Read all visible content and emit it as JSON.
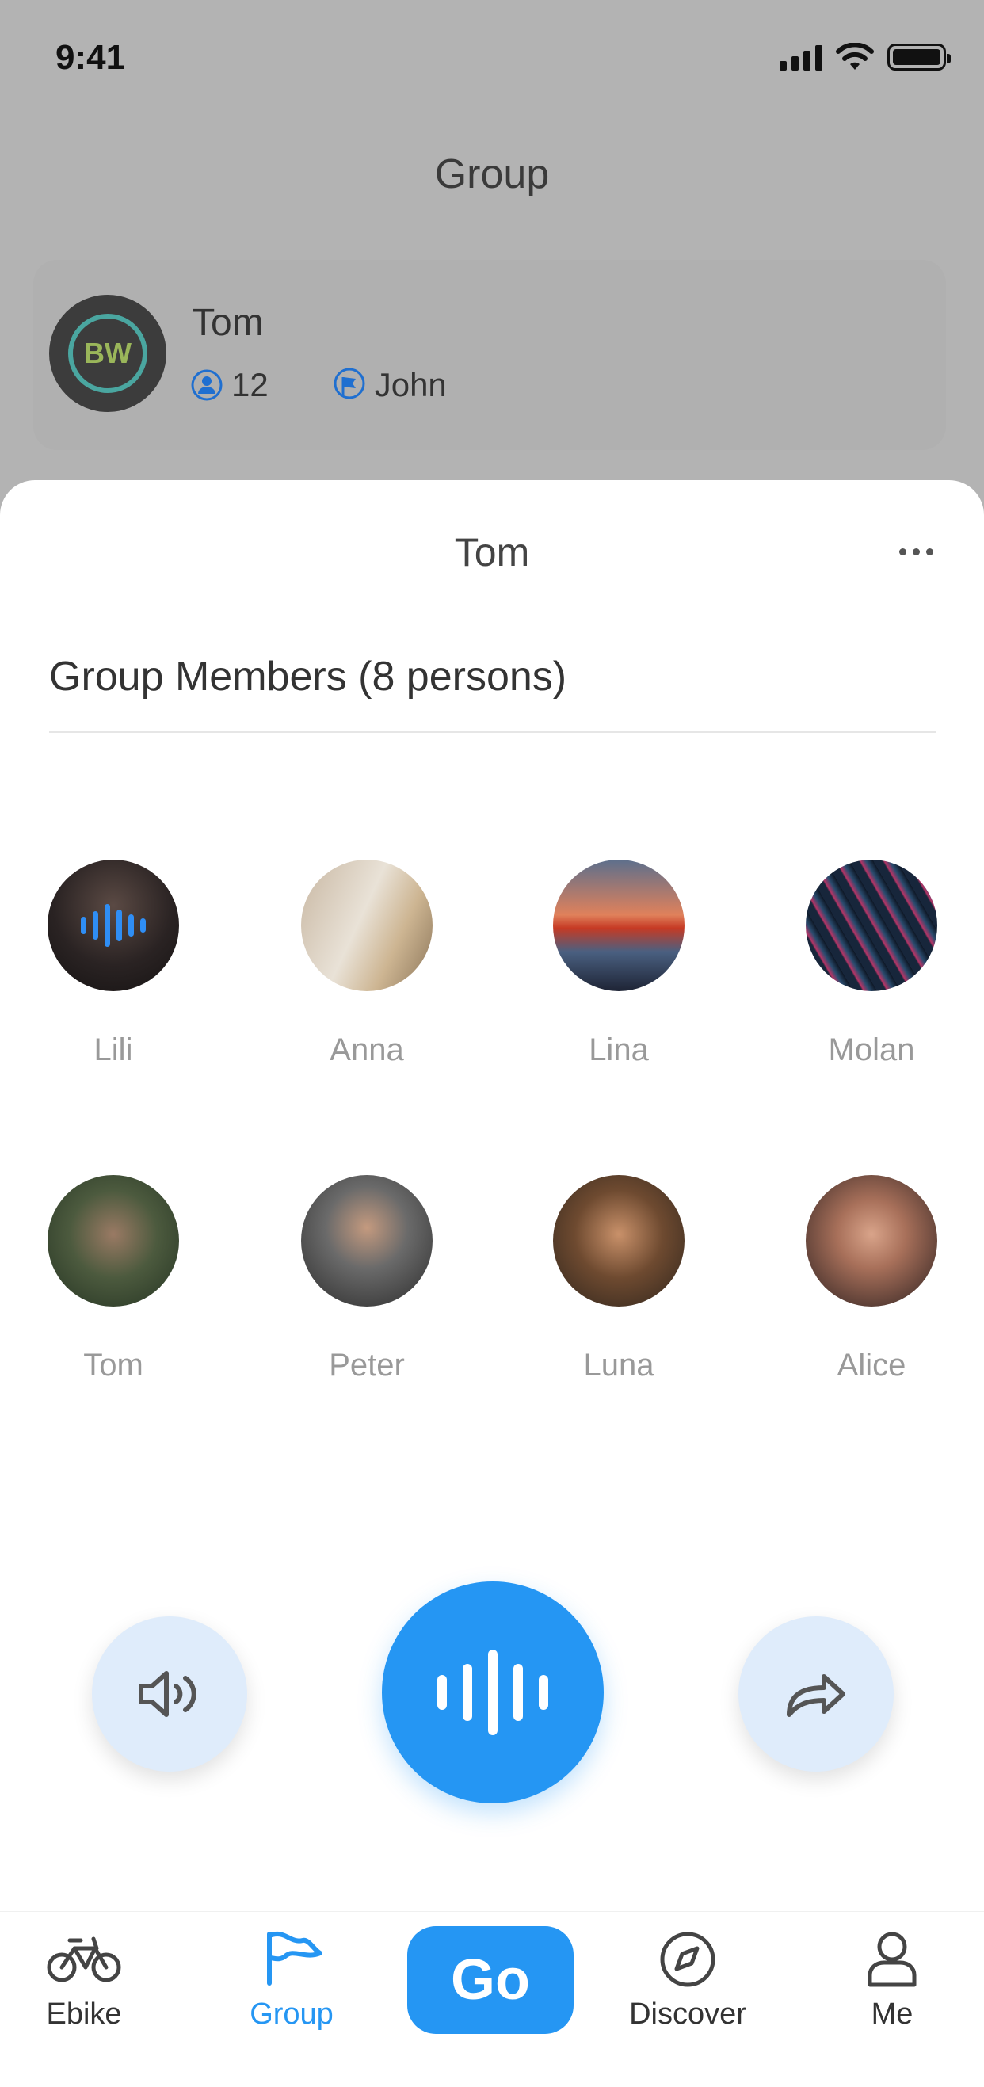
{
  "status": {
    "time": "9:41"
  },
  "background": {
    "title": "Group",
    "group": {
      "name": "Tom",
      "logo_text": "BW",
      "member_count": "12",
      "leader": "John"
    }
  },
  "sheet": {
    "title": "Tom",
    "members_title": "Group Members (8 persons)",
    "members": [
      {
        "name": "Lili",
        "speaking": true
      },
      {
        "name": "Anna"
      },
      {
        "name": "Lina"
      },
      {
        "name": "Molan"
      },
      {
        "name": "Tom"
      },
      {
        "name": "Peter"
      },
      {
        "name": "Luna"
      },
      {
        "name": "Alice"
      }
    ]
  },
  "controls": {
    "speaker_icon": "speaker-icon",
    "talk_icon": "voice-wave-icon",
    "share_icon": "share-icon"
  },
  "tabbar": {
    "items": [
      {
        "label": "Ebike"
      },
      {
        "label": "Group"
      },
      {
        "label": "Go"
      },
      {
        "label": "Discover"
      },
      {
        "label": "Me"
      }
    ],
    "active_color": "#2596f3"
  }
}
